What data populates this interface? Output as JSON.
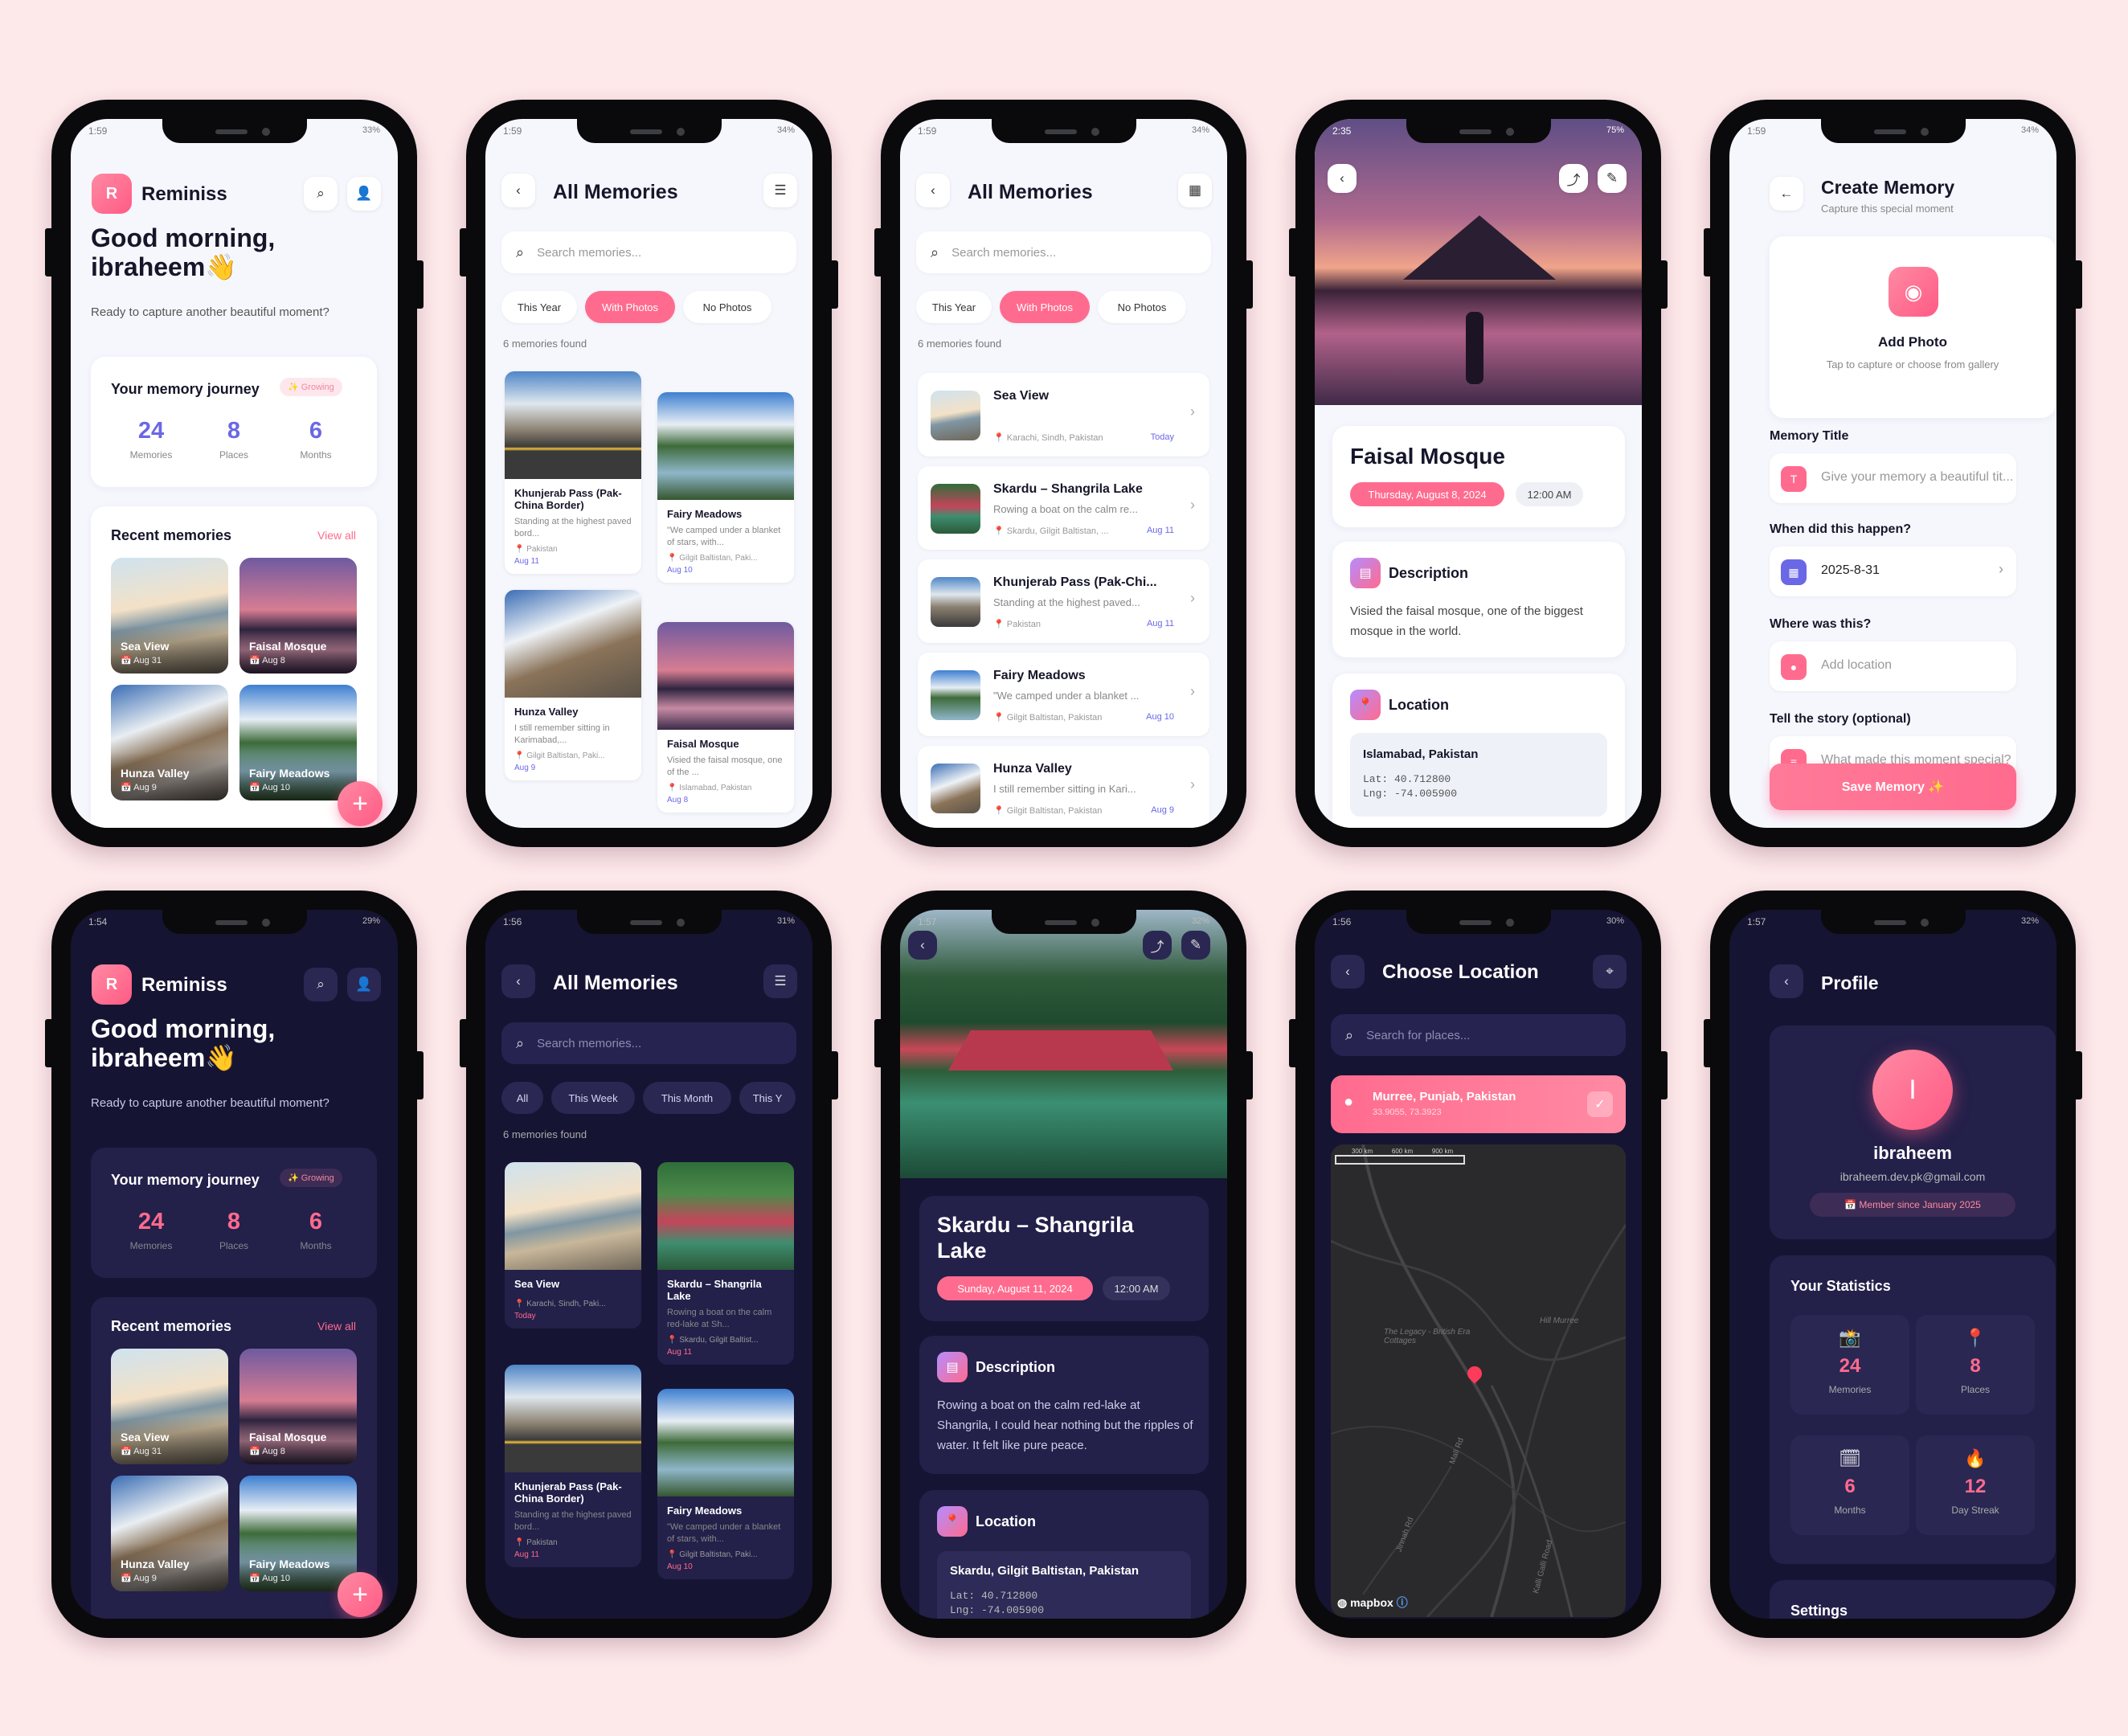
{
  "colors": {
    "background": "#fde8ea",
    "accent": "#ff6b8e",
    "light_stat": "#6a68e6",
    "dark_bg": "#161433"
  },
  "home_light": {
    "time": "1:59",
    "battery": "33%",
    "app_name": "Reminiss",
    "logo_letter": "R",
    "greeting": "Good morning,",
    "user": "ibraheem👋",
    "subtitle": "Ready to capture another beautiful moment?",
    "journey_title": "Your memory journey",
    "growing": "✨ Growing",
    "stats": [
      {
        "value": "24",
        "label": "Memories"
      },
      {
        "value": "8",
        "label": "Places"
      },
      {
        "value": "6",
        "label": "Months"
      }
    ],
    "recent_title": "Recent memories",
    "view_all": "View all",
    "tiles": [
      {
        "title": "Sea View",
        "date": "Aug 31"
      },
      {
        "title": "Faisal Mosque",
        "date": "Aug 8"
      },
      {
        "title": "Hunza Valley",
        "date": "Aug 9"
      },
      {
        "title": "Fairy Meadows",
        "date": "Aug 10"
      }
    ],
    "fab": "+"
  },
  "grid_light": {
    "time": "1:59",
    "battery": "34%",
    "title": "All Memories",
    "search_placeholder": "Search memories...",
    "chips": [
      "This Year",
      "With Photos",
      "No Photos"
    ],
    "found": "6 memories found",
    "left": [
      {
        "title": "Khunjerab Pass (Pak-China Border)",
        "text": "Standing at the highest paved bord...",
        "place": "Pakistan",
        "date": "Aug 11"
      },
      {
        "title": "Hunza Valley",
        "text": "I still remember sitting in Karimabad,...",
        "place": "Gilgit Baltistan, Paki...",
        "date": "Aug 9"
      }
    ],
    "right": [
      {
        "title": "Fairy Meadows",
        "text": "\"We camped under a blanket of stars, with...",
        "place": "Gilgit Baltistan, Paki...",
        "date": "Aug 10"
      },
      {
        "title": "Faisal Mosque",
        "text": "Visied the faisal mosque, one of the ...",
        "place": "Islamabad, Pakistan",
        "date": "Aug 8"
      }
    ]
  },
  "list_light": {
    "time": "1:59",
    "battery": "34%",
    "title": "All Memories",
    "search_placeholder": "Search memories...",
    "chips": [
      "This Year",
      "With Photos",
      "No Photos"
    ],
    "found": "6 memories found",
    "rows": [
      {
        "title": "Sea View",
        "text": "",
        "place": "Karachi, Sindh, Pakistan",
        "date": "Today"
      },
      {
        "title": "Skardu – Shangrila Lake",
        "text": "Rowing a boat on the calm re...",
        "place": "Skardu, Gilgit Baltistan, ...",
        "date": "Aug 11"
      },
      {
        "title": "Khunjerab Pass (Pak-Chi...",
        "text": "Standing at the highest paved...",
        "place": "Pakistan",
        "date": "Aug 11"
      },
      {
        "title": "Fairy Meadows",
        "text": "\"We camped under a blanket ...",
        "place": "Gilgit Baltistan, Pakistan",
        "date": "Aug 10"
      },
      {
        "title": "Hunza Valley",
        "text": "I still remember sitting in Kari...",
        "place": "Gilgit Baltistan, Pakistan",
        "date": "Aug 9"
      }
    ]
  },
  "detail_light": {
    "time": "2:35",
    "battery": "75%",
    "title": "Faisal Mosque",
    "date": "Thursday, August 8, 2024",
    "clock": "12:00 AM",
    "desc_title": "Description",
    "desc": "Visied the faisal mosque, one of the biggest mosque in the world.",
    "loc_title": "Location",
    "place": "Islamabad, Pakistan",
    "lat": "Lat: 40.712800",
    "lng": "Lng: -74.005900"
  },
  "create_light": {
    "time": "1:59",
    "battery": "34%",
    "title": "Create Memory",
    "subtitle": "Capture this special moment",
    "add_photo": "Add Photo",
    "add_photo_hint": "Tap to capture or choose from gallery",
    "title_label": "Memory Title",
    "title_placeholder": "Give your memory a beautiful tit...",
    "when_label": "When did this happen?",
    "when_value": "2025-8-31",
    "where_label": "Where was this?",
    "where_placeholder": "Add location",
    "story_label": "Tell the story (optional)",
    "story_placeholder": "What made this moment special?",
    "save": "Save Memory ✨"
  },
  "home_dark": {
    "time": "1:54",
    "battery": "29%",
    "app_name": "Reminiss",
    "logo_letter": "R",
    "greeting": "Good morning,",
    "user": "ibraheem👋",
    "subtitle": "Ready to capture another beautiful moment?",
    "journey_title": "Your memory journey",
    "growing": "✨ Growing",
    "stats": [
      {
        "value": "24",
        "label": "Memories"
      },
      {
        "value": "8",
        "label": "Places"
      },
      {
        "value": "6",
        "label": "Months"
      }
    ],
    "recent_title": "Recent memories",
    "view_all": "View all",
    "tiles": [
      {
        "title": "Sea View",
        "date": "Aug 31"
      },
      {
        "title": "Faisal Mosque",
        "date": "Aug 8"
      },
      {
        "title": "Hunza Valley",
        "date": "Aug 9"
      },
      {
        "title": "Fairy Meadows",
        "date": "Aug 10"
      }
    ],
    "fab": "+"
  },
  "grid_dark": {
    "time": "1:56",
    "battery": "31%",
    "title": "All Memories",
    "search_placeholder": "Search memories...",
    "chips": [
      "All",
      "This Week",
      "This Month",
      "This Y"
    ],
    "found": "6 memories found",
    "left": [
      {
        "title": "Sea View",
        "text": "",
        "place": "Karachi, Sindh, Paki...",
        "date": "Today"
      },
      {
        "title": "Khunjerab Pass (Pak-China Border)",
        "text": "Standing at the highest paved bord...",
        "place": "Pakistan",
        "date": "Aug 11"
      }
    ],
    "right": [
      {
        "title": "Skardu – Shangrila Lake",
        "text": "Rowing a boat on the calm red-lake at Sh...",
        "place": "Skardu, Gilgit Baltist...",
        "date": "Aug 11"
      },
      {
        "title": "Fairy Meadows",
        "text": "\"We camped under a blanket of stars, with...",
        "place": "Gilgit Baltistan, Paki...",
        "date": "Aug 10"
      }
    ]
  },
  "detail_dark": {
    "time": "1:57",
    "battery": "32%",
    "title": "Skardu – Shangrila Lake",
    "date": "Sunday, August 11, 2024",
    "clock": "12:00 AM",
    "desc_title": "Description",
    "desc": "Rowing a boat on the calm red-lake at Shangrila, I could hear nothing but the ripples of water. It felt like pure peace.",
    "loc_title": "Location",
    "place": "Skardu, Gilgit Baltistan, Pakistan",
    "lat": "Lat: 40.712800",
    "lng": "Lng: -74.005900"
  },
  "location_dark": {
    "time": "1:56",
    "battery": "30%",
    "title": "Choose Location",
    "search_placeholder": "Search for places...",
    "selected": "Murree, Punjab, Pakistan",
    "coords": "33.9055, 73.3923",
    "scale": [
      "300 km",
      "600 km",
      "900 km"
    ],
    "map_labels": [
      "The Legacy - British Era Cottages",
      "Hill Murree",
      "Mall Rd",
      "Jinnah Rd",
      "Kalli Galli Road"
    ],
    "attribution": "mapbox"
  },
  "profile_dark": {
    "time": "1:57",
    "battery": "32%",
    "title": "Profile",
    "avatar_letter": "I",
    "name": "ibraheem",
    "email": "ibraheem.dev.pk@gmail.com",
    "member": "Member since January 2025",
    "stats_title": "Your Statistics",
    "stats": [
      {
        "icon": "📸",
        "value": "24",
        "label": "Memories"
      },
      {
        "icon": "📍",
        "value": "8",
        "label": "Places"
      },
      {
        "icon": "🗓",
        "value": "6",
        "label": "Months"
      },
      {
        "icon": "🔥",
        "value": "12",
        "label": "Day Streak"
      }
    ],
    "settings": "Settings"
  }
}
